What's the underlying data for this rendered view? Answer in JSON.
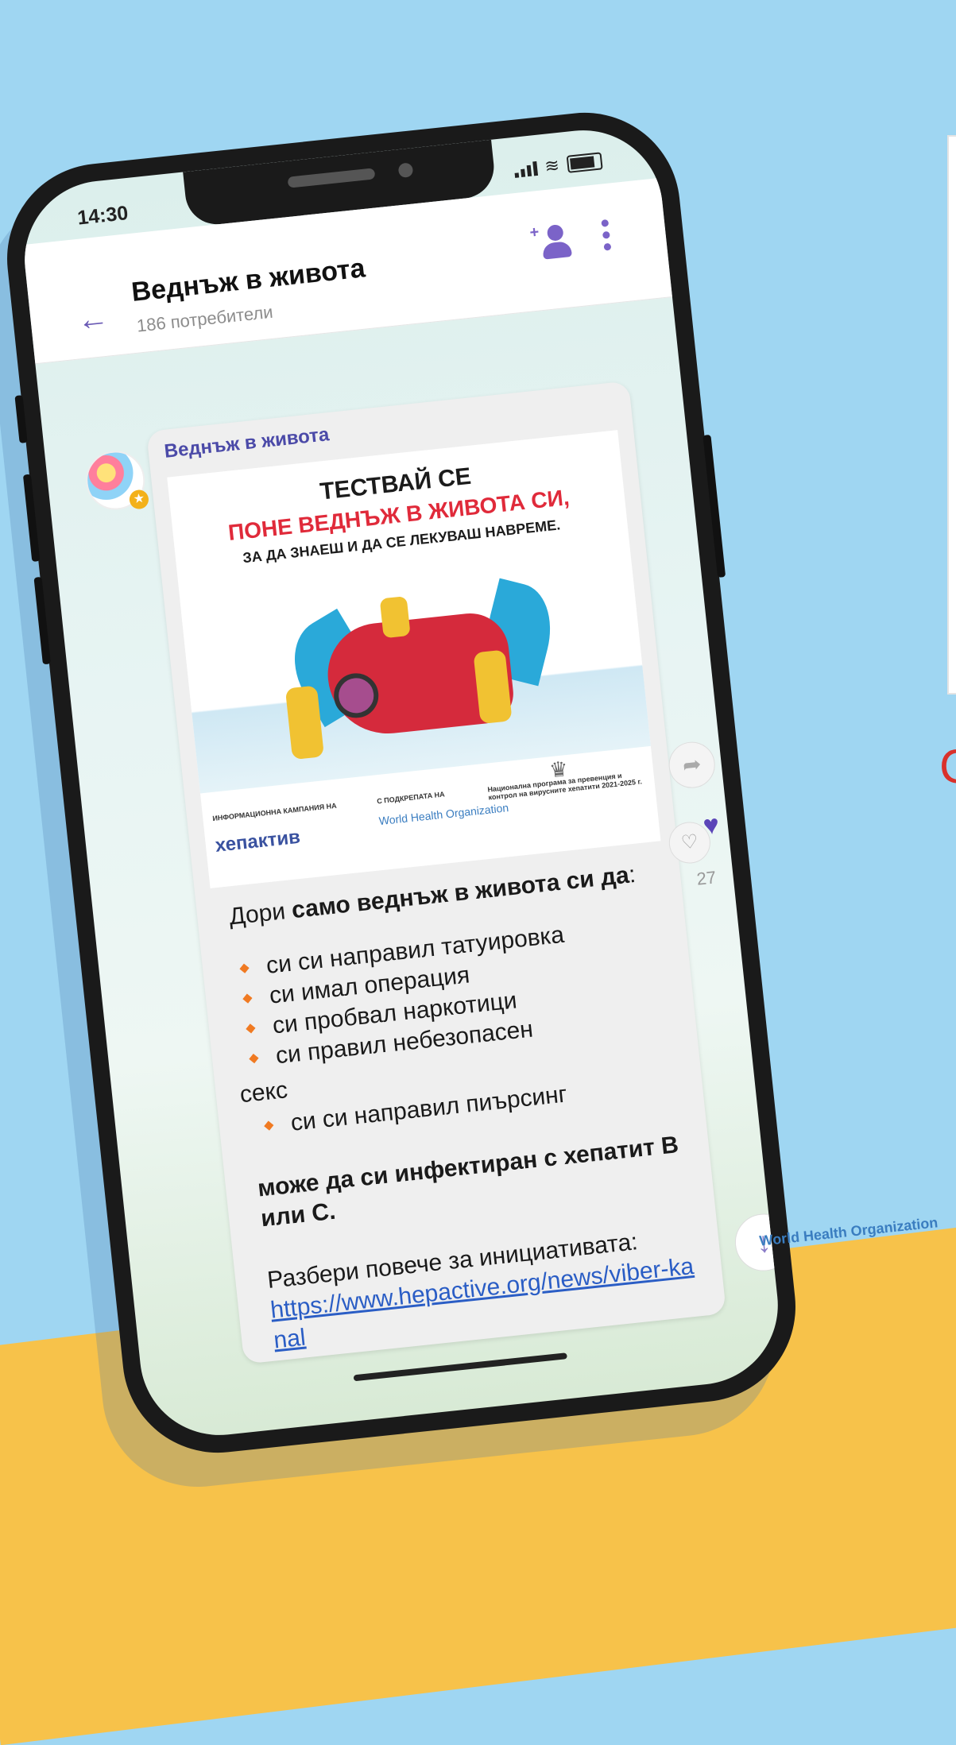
{
  "status_bar": {
    "time": "14:30"
  },
  "header": {
    "title": "Веднъж в живота",
    "subtitle": "186 потребители"
  },
  "message": {
    "sender": "Веднъж в живота",
    "poster": {
      "line1": "ТЕСТВАЙ СЕ",
      "line2": "ПОНЕ ВЕДНЪЖ В ЖИВОТА СИ,",
      "line3": "ЗА ДА ЗНАЕШ И ДА СЕ ЛЕКУВАШ НАВРЕМЕ.",
      "campaign_label": "ИНФОРМАЦИОННА КАМПАНИЯ НА",
      "hep_logo": "хепактив",
      "support_label": "С ПОДКРЕПАТА НА",
      "who_logo": "World Health Organization",
      "program_label": "Национална програма за превенция и контрол на вирусните хепатити 2021-2025 г."
    },
    "intro_plain": "Дори ",
    "intro_bold": "само веднъж в живота си да",
    "intro_end": ":",
    "items": [
      "си си направил татуировка",
      "си имал операция",
      "си пробвал наркотици",
      "си правил небезопасен"
    ],
    "items_continuation": "секс",
    "items2": [
      "си си направил пиърсинг"
    ],
    "warning": "може да си инфектиран с хепатит В или С.",
    "more_text": "Разбери повече за инициативата:",
    "link": "https://www.hepactive.org/news/viber-kanal"
  },
  "reactions": {
    "likes": "27"
  },
  "background": {
    "logo": "World Health Organization",
    "letter": "C"
  }
}
